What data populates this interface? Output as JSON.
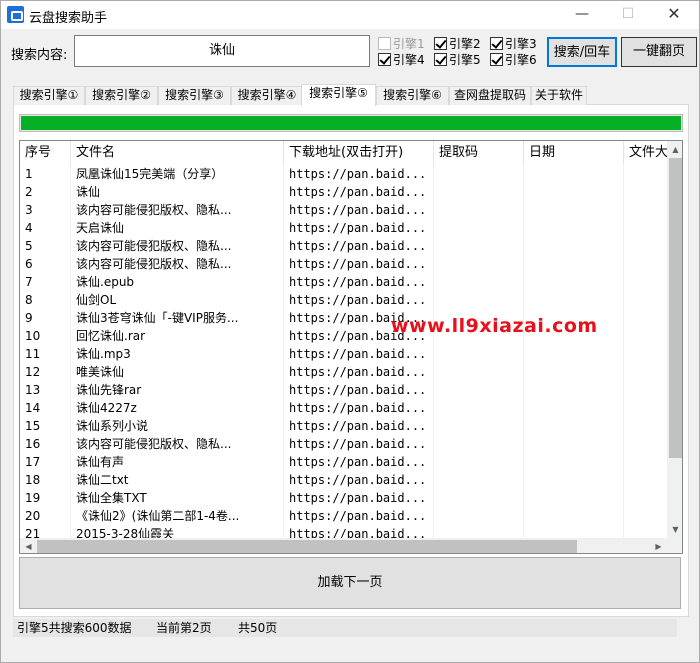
{
  "window": {
    "title": "云盘搜索助手",
    "minimize": "—",
    "maximize": "☐",
    "close": "✕"
  },
  "search": {
    "label": "搜索内容:",
    "value": "诛仙"
  },
  "engines": [
    {
      "label": "引擎1",
      "checked": false,
      "disabled": true
    },
    {
      "label": "引擎2",
      "checked": true
    },
    {
      "label": "引擎3",
      "checked": true
    },
    {
      "label": "引擎4",
      "checked": true
    },
    {
      "label": "引擎5",
      "checked": true
    },
    {
      "label": "引擎6",
      "checked": true
    }
  ],
  "buttons": {
    "search": "搜索/回车",
    "flip": "一键翻页",
    "load_next": "加载下一页"
  },
  "tabs": [
    {
      "label": "搜索引擎①"
    },
    {
      "label": "搜索引擎②"
    },
    {
      "label": "搜索引擎③"
    },
    {
      "label": "搜索引擎④"
    },
    {
      "label": "搜索引擎⑤",
      "active": true
    },
    {
      "label": "搜索引擎⑥"
    },
    {
      "label": "查网盘提取码"
    },
    {
      "label": "关于软件"
    }
  ],
  "progress": 1.0,
  "table": {
    "headers": [
      "序号",
      "文件名",
      "下载地址(双击打开)",
      "提取码",
      "日期",
      "文件大"
    ],
    "rows": [
      [
        "1",
        "凤凰诛仙15完美端（分享）",
        "https://pan.baid...",
        "",
        ""
      ],
      [
        "2",
        "诛仙",
        "https://pan.baid...",
        "",
        ""
      ],
      [
        "3",
        "该内容可能侵犯版权、隐私...",
        "https://pan.baid...",
        "",
        ""
      ],
      [
        "4",
        "天启诛仙",
        "https://pan.baid...",
        "",
        ""
      ],
      [
        "5",
        "该内容可能侵犯版权、隐私...",
        "https://pan.baid...",
        "",
        ""
      ],
      [
        "6",
        "该内容可能侵犯版权、隐私...",
        "https://pan.baid...",
        "",
        ""
      ],
      [
        "7",
        "诛仙.epub",
        "https://pan.baid...",
        "",
        ""
      ],
      [
        "8",
        "仙剑OL",
        "https://pan.baid...",
        "",
        ""
      ],
      [
        "9",
        "诛仙3苍穹诛仙「-键VIP服务...",
        "https://pan.baid...",
        "",
        ""
      ],
      [
        "10",
        "回忆诛仙.rar",
        "https://pan.baid...",
        "",
        ""
      ],
      [
        "11",
        "诛仙.mp3",
        "https://pan.baid...",
        "",
        ""
      ],
      [
        "12",
        "唯美诛仙",
        "https://pan.baid...",
        "",
        ""
      ],
      [
        "13",
        "诛仙先锋rar",
        "https://pan.baid...",
        "",
        ""
      ],
      [
        "14",
        "诛仙4227z",
        "https://pan.baid...",
        "",
        ""
      ],
      [
        "15",
        "诛仙系列小说",
        "https://pan.baid...",
        "",
        ""
      ],
      [
        "16",
        "该内容可能侵犯版权、隐私...",
        "https://pan.baid...",
        "",
        ""
      ],
      [
        "17",
        "诛仙有声",
        "https://pan.baid...",
        "",
        ""
      ],
      [
        "18",
        "诛仙二txt",
        "https://pan.baid...",
        "",
        ""
      ],
      [
        "19",
        "诛仙全集TXT",
        "https://pan.baid...",
        "",
        ""
      ],
      [
        "20",
        "《诛仙2》(诛仙第二部1-4卷...",
        "https://pan.baid...",
        "",
        ""
      ],
      [
        "21",
        "2015-3-28仙霞关",
        "https://pan.baid...",
        "",
        ""
      ]
    ]
  },
  "watermark": "www.ll9xiazai.com",
  "status": {
    "summary": "引擎5共搜索600数据",
    "current_page": "当前第2页",
    "total_pages": "共50页"
  }
}
